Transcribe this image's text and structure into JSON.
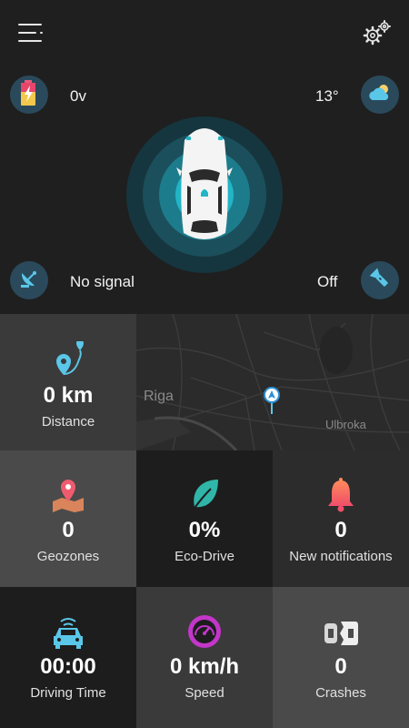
{
  "header": {
    "menu_icon": "hamburger-menu-icon",
    "settings_icon": "gears-icon"
  },
  "status": {
    "battery": {
      "icon": "battery-charging-icon",
      "value": "0v"
    },
    "weather": {
      "icon": "cloud-sun-icon",
      "value": "13°"
    },
    "signal": {
      "icon": "satellite-dish-icon",
      "value": "No signal"
    },
    "flashlight": {
      "icon": "flashlight-icon",
      "value": "Off"
    }
  },
  "map": {
    "city_label": "Riga",
    "district_label": "Ulbroka"
  },
  "tiles": {
    "distance": {
      "value": "0 km",
      "label": "Distance"
    },
    "geozones": {
      "value": "0",
      "label": "Geozones"
    },
    "eco_drive": {
      "value": "0%",
      "label": "Eco-Drive"
    },
    "notifications": {
      "value": "0",
      "label": "New notifications"
    },
    "driving_time": {
      "value": "00:00",
      "label": "Driving Time"
    },
    "speed": {
      "value": "0 km/h",
      "label": "Speed"
    },
    "crashes": {
      "value": "0",
      "label": "Crashes"
    }
  },
  "colors": {
    "accent": "#1fb6c7",
    "icon_bg": "#2a4a5c"
  }
}
